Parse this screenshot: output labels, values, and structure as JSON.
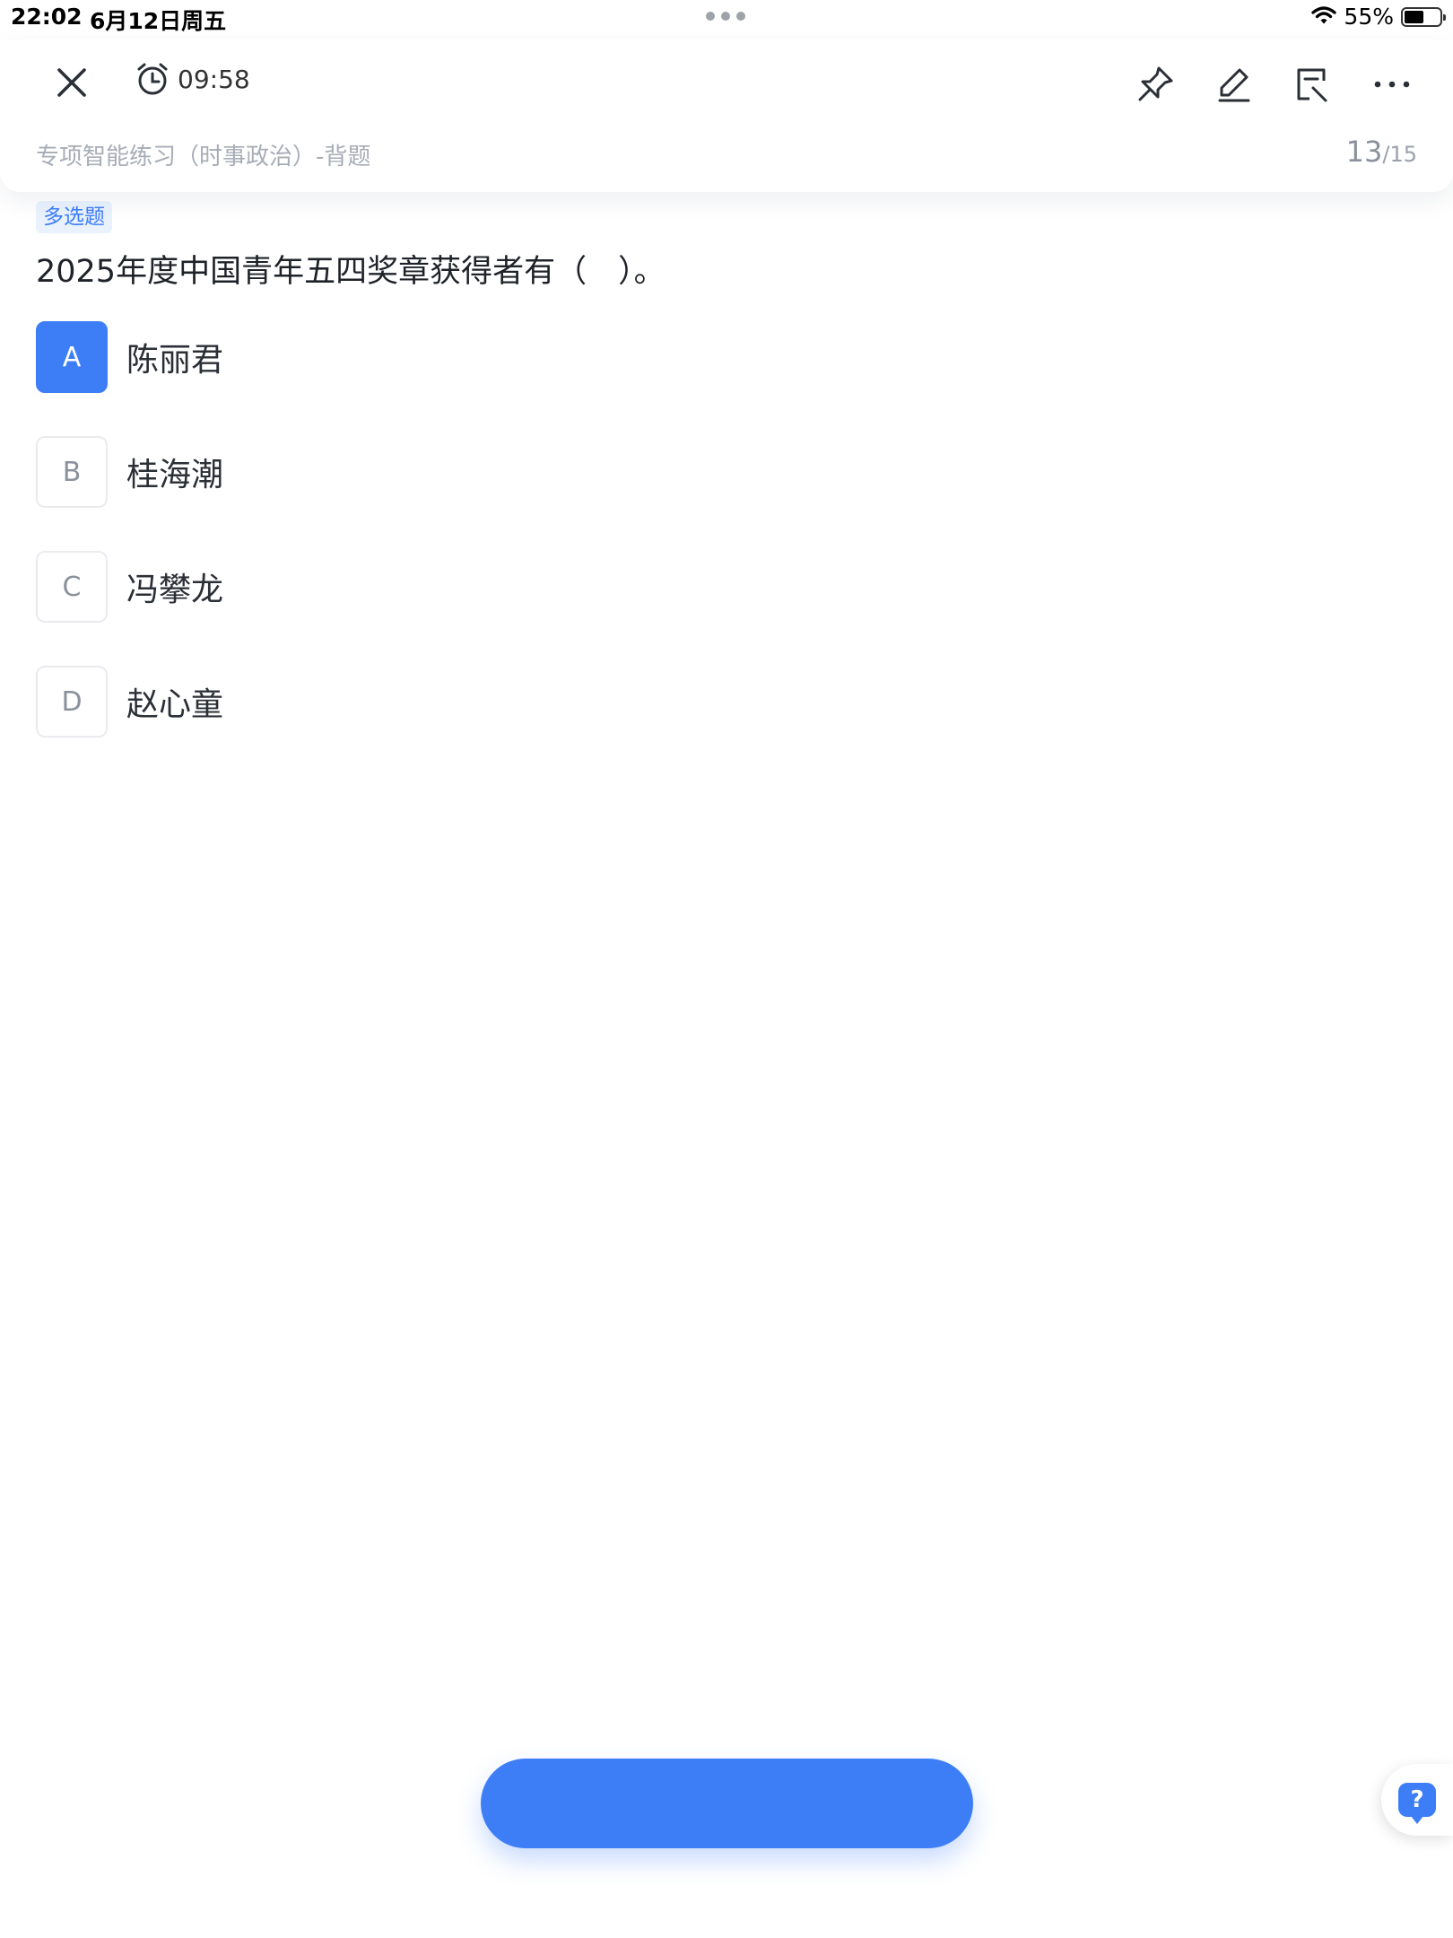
{
  "status_bar": {
    "time": "22:02",
    "date": "6月12日周五",
    "battery_percent": "55%",
    "battery_level": 0.55
  },
  "header": {
    "timer": "09:58",
    "breadcrumb": "专项智能练习（时事政治）-背题",
    "progress_current": "13",
    "progress_total": "/15",
    "icons": [
      "close-icon",
      "alarm-clock-icon",
      "pin-icon",
      "pencil-icon",
      "notes-icon",
      "more-icon"
    ]
  },
  "question": {
    "type": "多选题",
    "text": "2025年度中国青年五四奖章获得者有（　）。",
    "options": [
      {
        "letter": "A",
        "text": "陈丽君",
        "selected": true
      },
      {
        "letter": "B",
        "text": "桂海潮",
        "selected": false
      },
      {
        "letter": "C",
        "text": "冯攀龙",
        "selected": false
      },
      {
        "letter": "D",
        "text": "赵心童",
        "selected": false
      }
    ]
  },
  "footer": {
    "submit_label": "",
    "help_label": "?"
  },
  "colors": {
    "accent": "#3d7ef7",
    "badge_bg": "#eaf2ff",
    "muted_text": "#a7adb7"
  }
}
